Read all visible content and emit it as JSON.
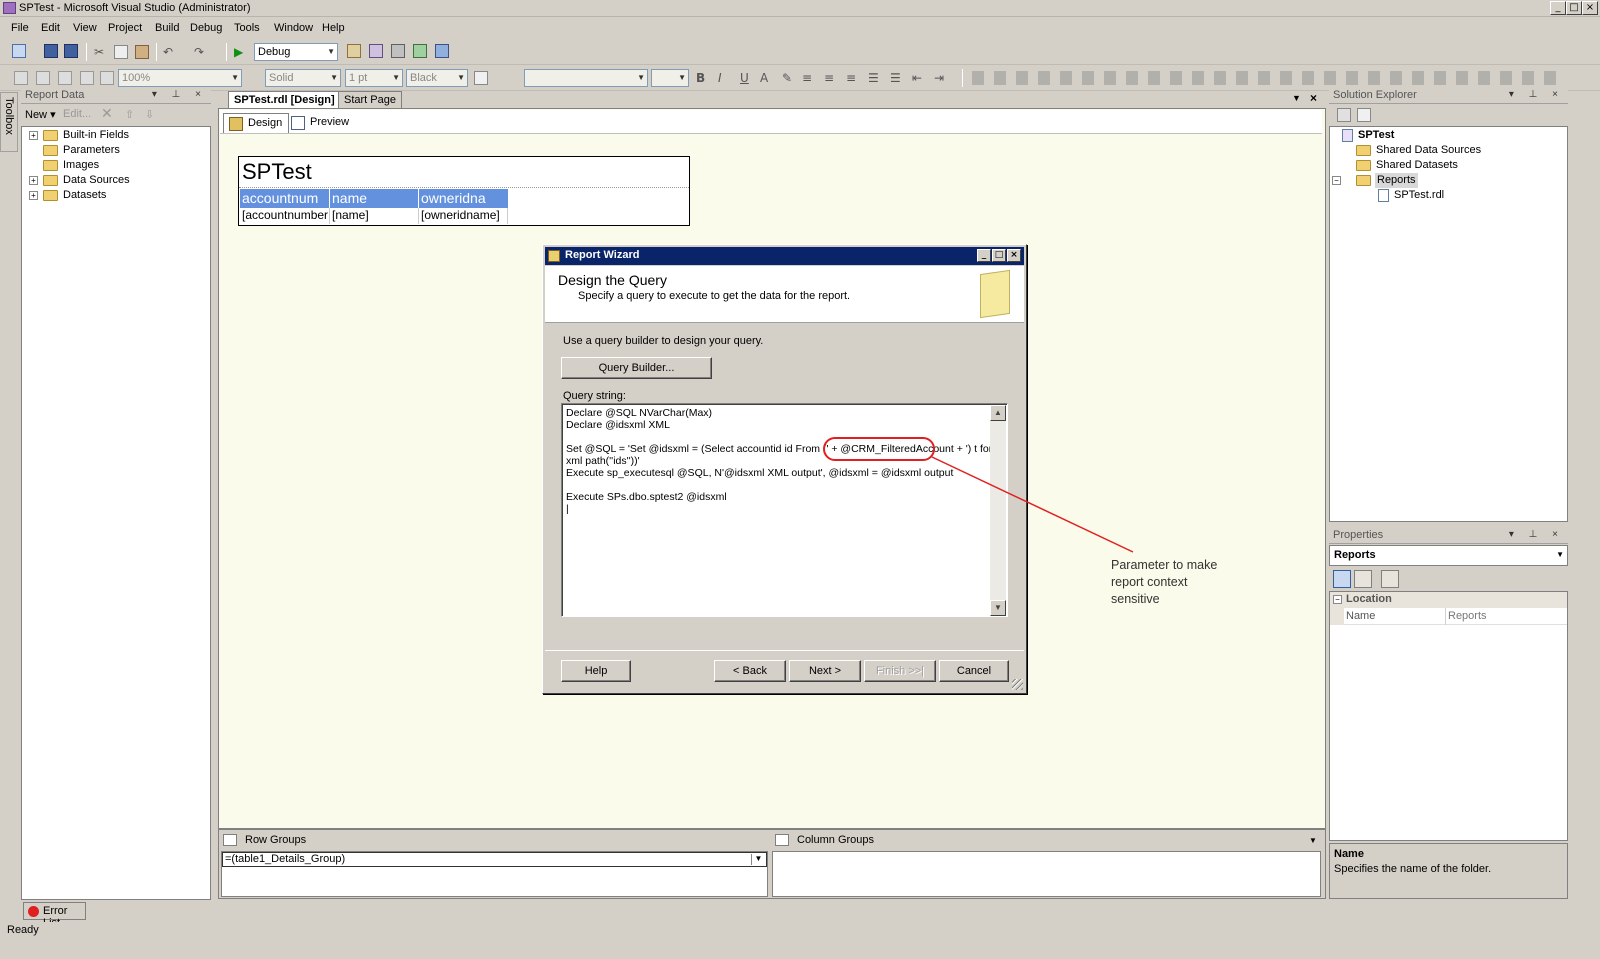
{
  "window": {
    "title": "SPTest - Microsoft Visual Studio (Administrator)"
  },
  "menu": [
    "File",
    "Edit",
    "View",
    "Project",
    "Build",
    "Debug",
    "Tools",
    "Window",
    "Help"
  ],
  "toolbar1": {
    "config_value": "Debug"
  },
  "toolbar2": {
    "zoom": "100%",
    "border_style": "Solid",
    "border_width": "1 pt",
    "border_color": "Black",
    "bold": "B",
    "italic": "I",
    "underline": "U"
  },
  "toolbox_strip": {
    "label": "Toolbox"
  },
  "report_data": {
    "title": "Report Data",
    "new_label": "New",
    "edit_label": "Edit...",
    "items": [
      "Built-in Fields",
      "Parameters",
      "Images",
      "Data Sources",
      "Datasets"
    ]
  },
  "doc_tabs": [
    "SPTest.rdl [Design]",
    "Start Page"
  ],
  "sub_tabs": [
    "Design",
    "Preview"
  ],
  "report": {
    "title": "SPTest",
    "headers": [
      "accountnum",
      "name",
      "owneridna"
    ],
    "cells": [
      "[accountnumber",
      "[name]",
      "[owneridname]"
    ]
  },
  "wizard": {
    "title": "Report Wizard",
    "heading": "Design the Query",
    "subheading": "Specify a query to execute to get the data for the report.",
    "builder_hint": "Use a query builder to design your query.",
    "query_builder_button": "Query Builder...",
    "query_label": "Query string:",
    "query_lines": [
      "Declare @SQL NVarChar(Max)",
      "Declare @idsxml XML",
      "",
      "Set @SQL = 'Set @idsxml = (Select accountid id From (' + @CRM_FilteredAccount + ') t for",
      "xml path(''ids''))'",
      "Execute sp_executesql @SQL, N'@idsxml XML output', @idsxml = @idsxml output",
      "",
      "Execute SPs.dbo.sptest2 @idsxml",
      "|"
    ],
    "buttons": {
      "help": "Help",
      "back": "< Back",
      "next": "Next >",
      "finish": "Finish >>|",
      "cancel": "Cancel"
    }
  },
  "annotation": {
    "lines": [
      "Parameter to make",
      "report context",
      "sensitive"
    ],
    "color": "#e02020"
  },
  "solution_explorer": {
    "title": "Solution Explorer",
    "project": "SPTest",
    "items": [
      "Shared Data Sources",
      "Shared Datasets",
      "Reports"
    ],
    "report_file": "SPTest.rdl"
  },
  "properties": {
    "title": "Properties",
    "selected": "Reports",
    "category": "Location",
    "prop_name": "Name",
    "prop_value": "Reports",
    "desc_title": "Name",
    "desc_text": "Specifies the name of the folder."
  },
  "groups": {
    "row_title": "Row Groups",
    "row_item": "=(table1_Details_Group)",
    "col_title": "Column Groups"
  },
  "error_list": "Error List",
  "status": "Ready",
  "colors": {
    "title_active": "#0a246a",
    "report_header": "#6391de",
    "design_bg": "#fbfbeb"
  }
}
